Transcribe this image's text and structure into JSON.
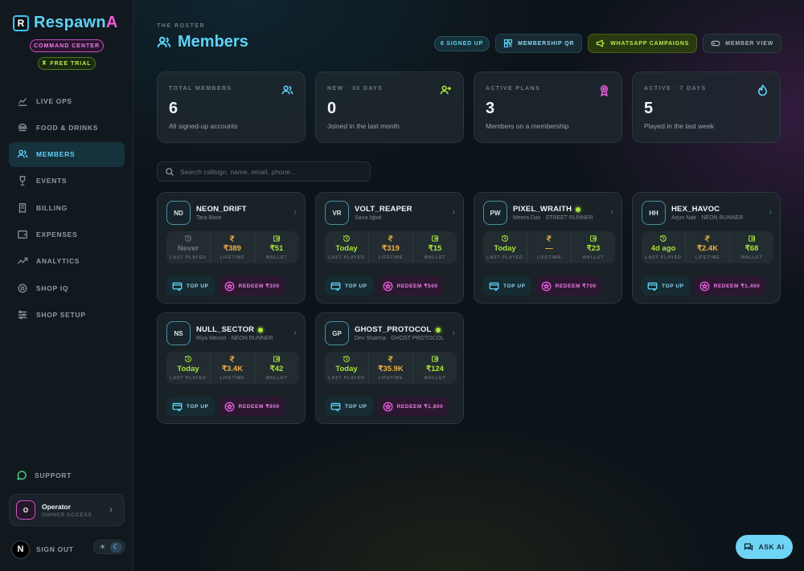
{
  "brand": {
    "name_main": "Respawn",
    "name_accent": "A",
    "mark": "R"
  },
  "sidebar": {
    "command_center": "COMMAND CENTER",
    "free_trial": "FREE TRIAL",
    "items": [
      {
        "label": "LIVE OPS",
        "icon": "chart-line-icon"
      },
      {
        "label": "FOOD & DRINKS",
        "icon": "burger-icon"
      },
      {
        "label": "MEMBERS",
        "icon": "users-icon",
        "active": true
      },
      {
        "label": "EVENTS",
        "icon": "trophy-icon"
      },
      {
        "label": "BILLING",
        "icon": "receipt-icon"
      },
      {
        "label": "EXPENSES",
        "icon": "wallet-icon"
      },
      {
        "label": "ANALYTICS",
        "icon": "trend-icon"
      },
      {
        "label": "SHOP IQ",
        "icon": "brain-icon"
      },
      {
        "label": "SHOP SETUP",
        "icon": "sliders-icon"
      }
    ],
    "support": "SUPPORT",
    "operator": {
      "initial": "O",
      "name": "Operator",
      "role": "OWNER ACCESS"
    },
    "n_badge": "N",
    "sign_out": "SIGN OUT",
    "theme_sun": "☀",
    "theme_moon": "☾"
  },
  "header": {
    "eyebrow": "THE ROSTER",
    "title": "Members",
    "signed_up": "6 SIGNED UP",
    "membership_qr": "MEMBERSHIP QR",
    "whatsapp": "WHATSAPP CAMPAIGNS",
    "member_view": "MEMBER VIEW"
  },
  "stats": [
    {
      "label": "TOTAL MEMBERS",
      "value": "6",
      "sub": "All signed-up accounts",
      "icon": "users-icon",
      "color": "#5fd3f7"
    },
    {
      "label": "NEW · 30 DAYS",
      "value": "0",
      "sub": "Joined in the last month",
      "icon": "user-plus-icon",
      "color": "#a8e63a"
    },
    {
      "label": "ACTIVE PLANS",
      "value": "3",
      "sub": "Members on a membership",
      "icon": "badge-icon",
      "color": "#e85ddb"
    },
    {
      "label": "ACTIVE · 7 DAYS",
      "value": "5",
      "sub": "Played in the last week",
      "icon": "flame-icon",
      "color": "#5fd3f7"
    }
  ],
  "search": {
    "placeholder": "Search callsign, name, email, phone..."
  },
  "labels": {
    "last_played": "LAST PLAYED",
    "lifetime": "LIFETIME",
    "wallet": "WALLET",
    "top_up": "TOP UP"
  },
  "members": [
    {
      "initials": "ND",
      "name": "NEON_DRIFT",
      "sub": "Tara Bose",
      "online": false,
      "last_played": "Never",
      "lifetime": "₹389",
      "wallet": "₹51",
      "redeem": "REDEEM ₹300"
    },
    {
      "initials": "VR",
      "name": "VOLT_REAPER",
      "sub": "Sana Iqbal",
      "online": false,
      "last_played": "Today",
      "lifetime": "₹319",
      "wallet": "₹15",
      "redeem": "REDEEM ₹500"
    },
    {
      "initials": "PW",
      "name": "PIXEL_WRAITH",
      "sub": "Meera Das · STREET RUNNER",
      "online": true,
      "last_played": "Today",
      "lifetime": "—",
      "wallet": "₹23",
      "redeem": "REDEEM ₹700"
    },
    {
      "initials": "HH",
      "name": "HEX_HAVOC",
      "sub": "Arjun Nair · NEON RUNNER",
      "online": false,
      "last_played": "4d ago",
      "lifetime": "₹2.4K",
      "wallet": "₹68",
      "redeem": "REDEEM ₹1,400"
    },
    {
      "initials": "NS",
      "name": "NULL_SECTOR",
      "sub": "Riya Menon · NEON RUNNER",
      "online": true,
      "last_played": "Today",
      "lifetime": "₹3.4K",
      "wallet": "₹42",
      "redeem": "REDEEM ₹900"
    },
    {
      "initials": "GP",
      "name": "GHOST_PROTOCOL",
      "sub": "Dev Sharma · GHOST PROTOCOL",
      "online": true,
      "last_played": "Today",
      "lifetime": "₹35.9K",
      "wallet": "₹124",
      "redeem": "REDEEM ₹1,800"
    }
  ],
  "ask_ai": "ASK AI",
  "colors": {
    "accent": "#5fd3f7",
    "pink": "#e85ddb",
    "lime": "#a8e63a",
    "orange": "#f2b042"
  }
}
